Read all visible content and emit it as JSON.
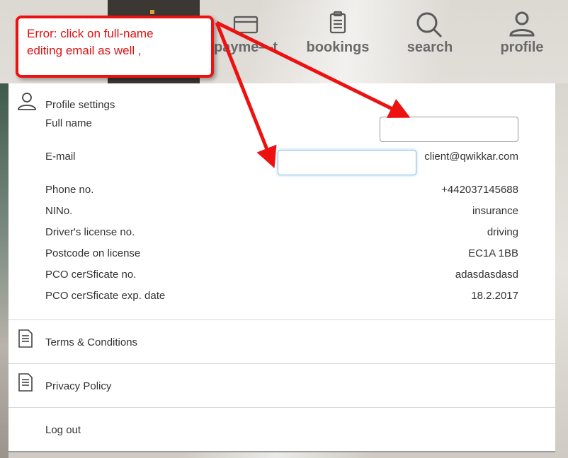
{
  "nav": {
    "items": [
      {
        "label": "payme—t",
        "icon": "card-icon"
      },
      {
        "label": "bookings",
        "icon": "clipboard-icon"
      },
      {
        "label": "search",
        "icon": "search-icon"
      },
      {
        "label": "profile",
        "icon": "user-icon"
      }
    ]
  },
  "annotation": {
    "text_line1": "Error: click on full-name",
    "text_line2": "editing email as well ,"
  },
  "profile": {
    "title": "Profile settings",
    "full_name_label": "Full name",
    "full_name_value": "",
    "email_label": "E-mail",
    "email_input_value": "",
    "email_value": "client@qwikkar.com",
    "rows": [
      {
        "label": "Phone no.",
        "value": "+442037145688"
      },
      {
        "label": "NINo.",
        "value": "insurance"
      },
      {
        "label": "Driver's license no.",
        "value": "driving"
      },
      {
        "label": "Postcode on license",
        "value": "EC1A 1BB"
      },
      {
        "label": "PCO cerSficate no.",
        "value": "adasdasdasd"
      },
      {
        "label": "PCO cerSficate exp. date",
        "value": "18.2.2017"
      }
    ]
  },
  "links": {
    "terms": "Terms & Conditions",
    "privacy": "Privacy Policy",
    "logout": "Log out"
  },
  "colors": {
    "annotation_red": "#e01010",
    "text": "#333333",
    "nav_text": "#6a6a6a"
  }
}
